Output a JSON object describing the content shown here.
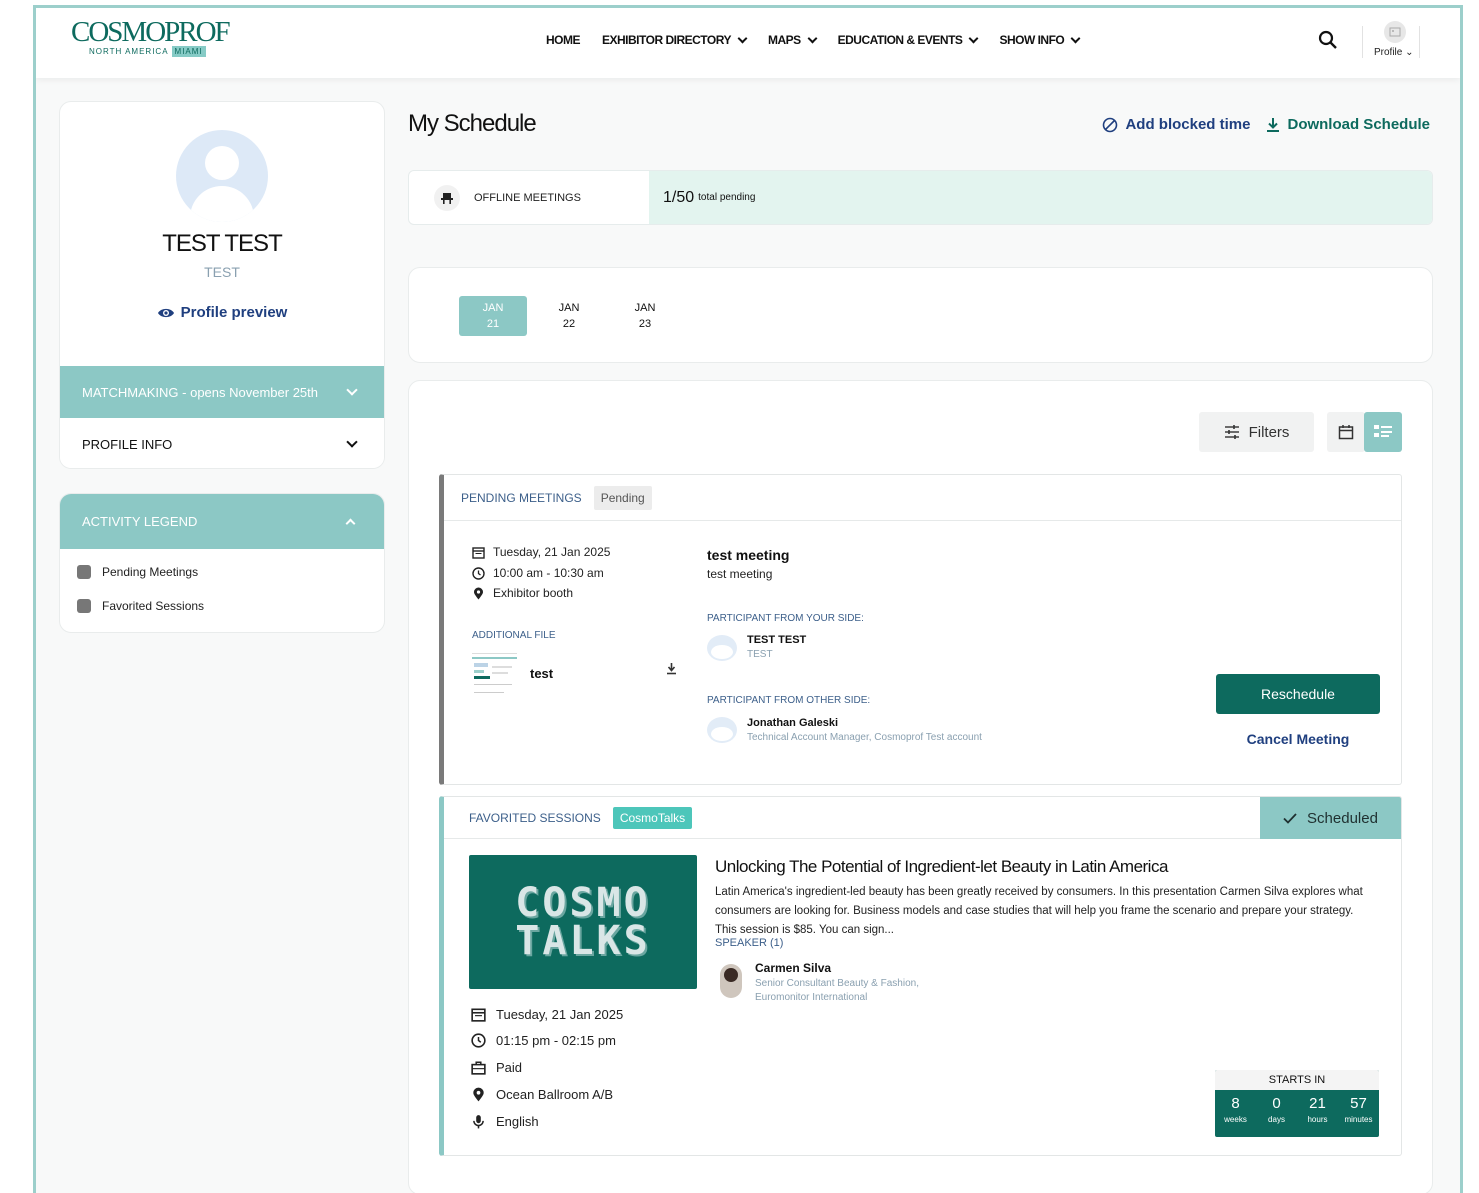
{
  "brand": {
    "word": "COSMOPROF",
    "sub": "NORTH AMERICA",
    "city": "MIAMI",
    "accent": "#0d6a5e",
    "teal": "#8cc8c5"
  },
  "nav": {
    "links": [
      {
        "label": "HOME",
        "dropdown": false
      },
      {
        "label": "EXHIBITOR DIRECTORY",
        "dropdown": true
      },
      {
        "label": "MAPS",
        "dropdown": true
      },
      {
        "label": "EDUCATION & EVENTS",
        "dropdown": true
      },
      {
        "label": "SHOW INFO",
        "dropdown": true
      }
    ],
    "profile_label": "Profile"
  },
  "profile": {
    "name": "TEST TEST",
    "company": "TEST",
    "preview": "Profile preview",
    "matchmaking": "MATCHMAKING - opens November 25th",
    "profile_info": "PROFILE INFO"
  },
  "legend": {
    "title": "ACTIVITY LEGEND",
    "items": [
      "Pending Meetings",
      "Favorited Sessions"
    ]
  },
  "schedule": {
    "title": "My Schedule",
    "add_blocked": "Add blocked time",
    "download": "Download Schedule",
    "offline_label": "OFFLINE MEETINGS",
    "pending_count": "1/50",
    "pending_text": "total pending",
    "dates": [
      {
        "month": "JAN",
        "day": "21",
        "active": true
      },
      {
        "month": "JAN",
        "day": "22",
        "active": false
      },
      {
        "month": "JAN",
        "day": "23",
        "active": false
      }
    ],
    "filters": "Filters"
  },
  "meeting": {
    "section": "PENDING MEETINGS",
    "badge": "Pending",
    "date": "Tuesday, 21 Jan 2025",
    "time": "10:00 am - 10:30 am",
    "location": "Exhibitor booth",
    "file_label": "ADDITIONAL FILE",
    "file_name": "test",
    "title": "test meeting",
    "subtitle": "test meeting",
    "your_side_label": "PARTICIPANT FROM YOUR SIDE:",
    "your_name": "TEST TEST",
    "your_company": "TEST",
    "other_side_label": "PARTICIPANT FROM OTHER SIDE:",
    "other_name": "Jonathan Galeski",
    "other_role": "Technical Account Manager, Cosmoprof Test account",
    "reschedule": "Reschedule",
    "cancel": "Cancel Meeting"
  },
  "session": {
    "section": "FAVORITED SESSIONS",
    "badge": "CosmoTalks",
    "status": "Scheduled",
    "image_line1": "COSMO",
    "image_line2": "TALKS",
    "title": "Unlocking The Potential of Ingredient-let Beauty in Latin America",
    "description": "Latin America's ingredient-led beauty has been greatly received by consumers. In this presentation Carmen Silva explores what consumers are looking for. Business models and case studies that will help you frame the scenario and prepare your strategy.  This session is $85. You can sign...",
    "speaker_label": "SPEAKER (1)",
    "speaker_name": "Carmen Silva",
    "speaker_role1": "Senior Consultant Beauty & Fashion,",
    "speaker_role2": "Euromonitor International",
    "date": "Tuesday, 21 Jan 2025",
    "time": "01:15 pm - 02:15 pm",
    "price": "Paid",
    "location": "Ocean Ballroom A/B",
    "language": "English",
    "countdown": {
      "label": "STARTS IN",
      "cells": [
        {
          "n": "8",
          "u": "weeks"
        },
        {
          "n": "0",
          "u": "days"
        },
        {
          "n": "21",
          "u": "hours"
        },
        {
          "n": "57",
          "u": "minutes"
        }
      ]
    }
  }
}
